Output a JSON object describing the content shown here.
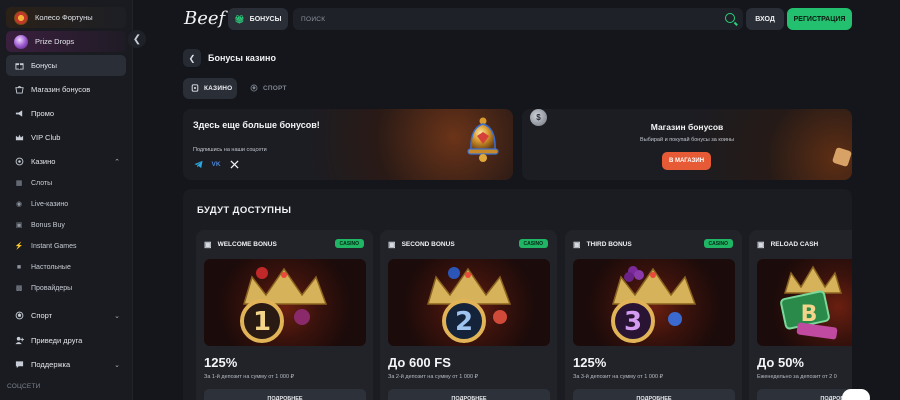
{
  "sidebar": {
    "items": [
      {
        "label": "Колесо Фортуны",
        "icon": "fortune-wheel-avatar"
      },
      {
        "label": "Prize Drops",
        "icon": "prize-drops-avatar"
      },
      {
        "label": "Бонусы",
        "icon": "gift-icon"
      },
      {
        "label": "Магазин бонусов",
        "icon": "shop-icon"
      },
      {
        "label": "Промо",
        "icon": "megaphone-icon"
      },
      {
        "label": "VIP Club",
        "icon": "crown-icon"
      },
      {
        "label": "Казино",
        "icon": "casino-icon"
      },
      {
        "label": "Спорт",
        "icon": "ball-icon"
      },
      {
        "label": "Приведи друга",
        "icon": "user-plus-icon"
      },
      {
        "label": "Поддержка",
        "icon": "chat-icon"
      }
    ],
    "casino_sub": [
      {
        "label": "Слоты",
        "icon": "slots-icon"
      },
      {
        "label": "Live-казино",
        "icon": "live-icon"
      },
      {
        "label": "Bonus Buy",
        "icon": "bonus-buy-icon"
      },
      {
        "label": "Instant Games",
        "icon": "instant-icon"
      },
      {
        "label": "Настольные",
        "icon": "table-games-icon"
      },
      {
        "label": "Провайдеры",
        "icon": "providers-icon"
      }
    ],
    "section_label": "СОЦСЕТИ"
  },
  "header": {
    "logo": "Beef",
    "bonus_button": "БОНУСЫ",
    "search_placeholder": "ПОИСК",
    "login": "ВХОД",
    "register": "РЕГИСТРАЦИЯ"
  },
  "page": {
    "title": "Бонусы казино",
    "tabs": [
      {
        "label": "КАЗИНО",
        "active": true
      },
      {
        "label": "СПОРТ",
        "active": false
      }
    ]
  },
  "banners": {
    "social": {
      "title": "Здесь еще больше бонусов!",
      "subtitle": "Подпишись на наши соцсети",
      "icons": [
        "telegram-icon",
        "vk-icon",
        "x-icon"
      ]
    },
    "shop": {
      "title": "Магазин бонусов",
      "subtitle": "Выбирай и покупай бонусы за коины",
      "button": "В МАГАЗИН"
    }
  },
  "upcoming": {
    "title": "БУДУТ ДОСТУПНЫ",
    "cards": [
      {
        "name": "WELCOME BONUS",
        "badge": "CASINO",
        "value": "125%",
        "desc": "За 1-й депозит на сумму от 1 000 ₽",
        "button": "ПОДРОБНЕЕ",
        "digit": "1"
      },
      {
        "name": "SECOND BONUS",
        "badge": "CASINO",
        "value": "До 600 FS",
        "desc": "За 2-й депозит на сумму от 1 000 ₽",
        "button": "ПОДРОБНЕЕ",
        "digit": "2"
      },
      {
        "name": "THIRD BONUS",
        "badge": "CASINO",
        "value": "125%",
        "desc": "За 3-й депозит на сумму от 1 000 ₽",
        "button": "ПОДРОБНЕЕ",
        "digit": "3"
      },
      {
        "name": "RELOAD CASH",
        "badge": "",
        "value": "До 50%",
        "desc": "Еженедельно за депозит от 2 0",
        "button": "ПОДРОБНЕЕ",
        "digit": "B"
      }
    ]
  },
  "colors": {
    "accent_green": "#22c06f",
    "shop_button": "#e65b36",
    "background": "#14161b"
  }
}
